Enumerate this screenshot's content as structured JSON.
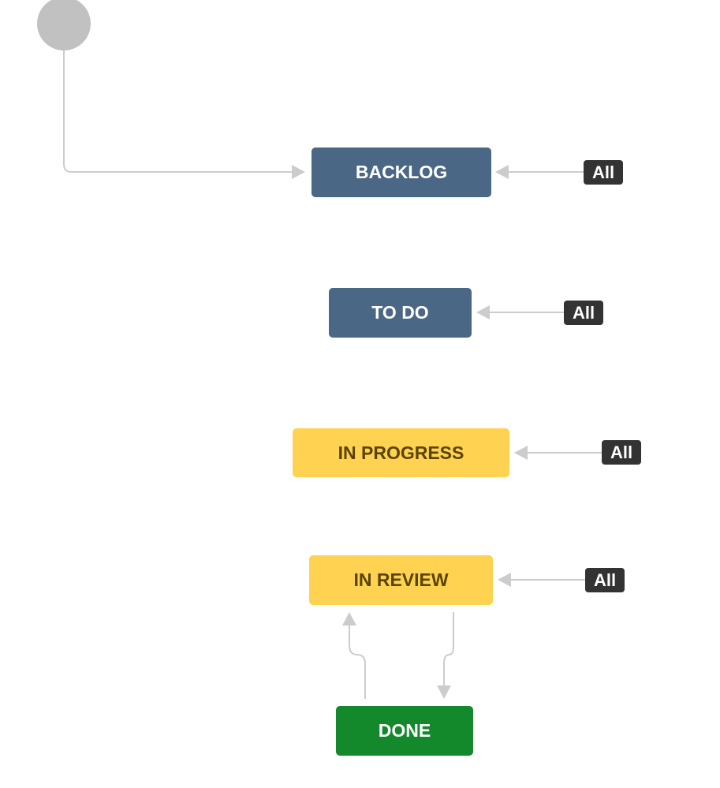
{
  "diagram": {
    "start_node": "start",
    "statuses": [
      {
        "id": "backlog",
        "label": "BACKLOG",
        "category": "todo"
      },
      {
        "id": "todo",
        "label": "TO DO",
        "category": "todo"
      },
      {
        "id": "in_progress",
        "label": "IN PROGRESS",
        "category": "in-progress"
      },
      {
        "id": "in_review",
        "label": "IN REVIEW",
        "category": "in-progress"
      },
      {
        "id": "done",
        "label": "DONE",
        "category": "done"
      }
    ],
    "global_transitions": [
      {
        "target": "backlog",
        "label": "All"
      },
      {
        "target": "todo",
        "label": "All"
      },
      {
        "target": "in_progress",
        "label": "All"
      },
      {
        "target": "in_review",
        "label": "All"
      }
    ],
    "transitions": [
      {
        "from": "start",
        "to": "backlog"
      },
      {
        "from": "done",
        "to": "in_review"
      },
      {
        "from": "in_review",
        "to": "done"
      }
    ],
    "colors": {
      "todo": "#4a6785",
      "in_progress": "#ffd351",
      "done": "#14892c",
      "all_badge": "#333333",
      "edge": "#c8c8c8",
      "start": "#c1c1c1"
    }
  }
}
